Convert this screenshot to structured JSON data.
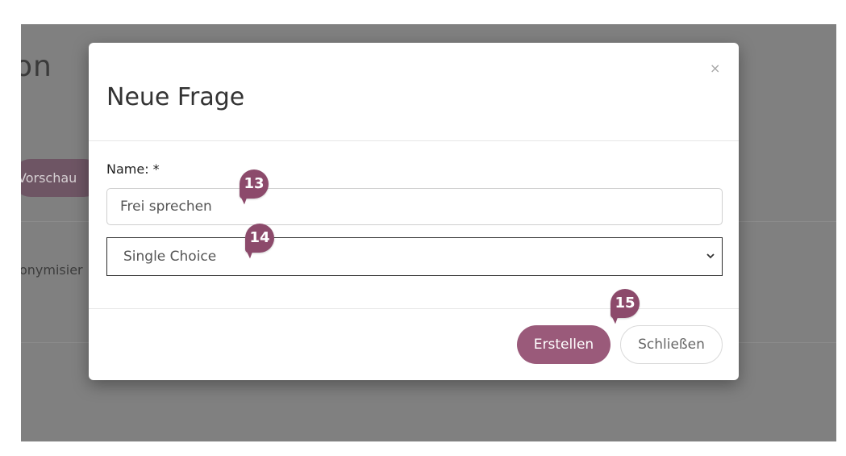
{
  "background": {
    "title_fragment": "on",
    "preview_button_fragment": "Vorschau",
    "anonymise_fragment": "onymisier"
  },
  "modal": {
    "title": "Neue Frage",
    "close_icon": "×",
    "name_label": "Name: *",
    "name_value": "Frei sprechen",
    "type_selected": "Single Choice",
    "create_button": "Erstellen",
    "close_button": "Schließen"
  },
  "markers": [
    "13",
    "14",
    "15"
  ],
  "colors": {
    "accent": "#9a5a7a",
    "marker": "#8c4a6b",
    "overlay": "#808080"
  }
}
